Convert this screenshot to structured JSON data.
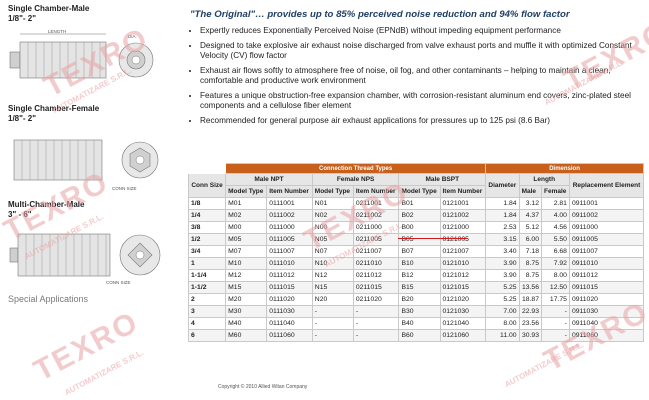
{
  "left": {
    "product1": {
      "title": "Single Chamber-Male",
      "size": "1/8\"- 2\"",
      "length_label": "LENGTH",
      "dia_label": "DIA."
    },
    "product2": {
      "title": "Single Chamber-Female",
      "size": "1/8\"- 2\"",
      "conn_label": "CONN SIZE"
    },
    "product3": {
      "title": "Multi-Chamber-Male",
      "size": "3\" - 6\"",
      "conn_label": "CONN SIZE"
    },
    "special_applications": "Special Applications"
  },
  "headline": "\"The Original\"… provides up to 85% perceived noise reduction and 94% flow factor",
  "bullets": [
    "Expertly reduces Exponentially Perceived Noise (EPNdB) without impeding equipment performance",
    "Designed to take explosive air exhaust noise discharged from valve exhaust ports and muffle it with optimized Constant Velocity (CV) flow factor",
    "Exhaust air flows softly to atmosphere free of noise, oil fog, and other contaminants – helping to maintain a clean, comfortable and productive work environment",
    "Features a unique obstruction-free expansion chamber, with corrosion-resistant aluminum end covers, zinc-plated steel components and a cellulose fiber element",
    "Recommended for general purpose air exhaust applications for pressures up to 125 psi (8.6 Bar)"
  ],
  "table": {
    "band_connection": "Connection Thread Types",
    "band_dimension": "Dimension",
    "conn_size": "Conn Size",
    "male_npt": "Male NPT",
    "female_nps": "Female NPS",
    "male_bspt": "Male BSPT",
    "diameter": "Diameter",
    "length": "Length",
    "replacement": "Replacement Element",
    "model_type": "Model Type",
    "item_number": "Item Number",
    "male": "Male",
    "female": "Female",
    "rows": [
      {
        "size": "1/8",
        "npt_m": "M01",
        "npt_i": "0111001",
        "nps_m": "N01",
        "nps_i": "0211001",
        "bspt_m": "B01",
        "bspt_i": "0121001",
        "dia": "1.84",
        "lm": "3.12",
        "lf": "2.81",
        "rep": "0911001"
      },
      {
        "size": "1/4",
        "npt_m": "M02",
        "npt_i": "0111002",
        "nps_m": "N02",
        "nps_i": "0211002",
        "bspt_m": "B02",
        "bspt_i": "0121002",
        "dia": "1.84",
        "lm": "4.37",
        "lf": "4.00",
        "rep": "0911002"
      },
      {
        "size": "3/8",
        "npt_m": "M00",
        "npt_i": "0111000",
        "nps_m": "N00",
        "nps_i": "0211000",
        "bspt_m": "B00",
        "bspt_i": "0121000",
        "dia": "2.53",
        "lm": "5.12",
        "lf": "4.56",
        "rep": "0911000"
      },
      {
        "size": "1/2",
        "npt_m": "M05",
        "npt_i": "0111005",
        "nps_m": "N05",
        "nps_i": "0211005",
        "bspt_m": "B05",
        "bspt_i": "0121005",
        "dia": "3.15",
        "lm": "6.00",
        "lf": "5.50",
        "rep": "0911005"
      },
      {
        "size": "3/4",
        "npt_m": "M07",
        "npt_i": "0111007",
        "nps_m": "N07",
        "nps_i": "0211007",
        "bspt_m": "B07",
        "bspt_i": "0121007",
        "dia": "3.40",
        "lm": "7.18",
        "lf": "6.68",
        "rep": "0911007"
      },
      {
        "size": "1",
        "npt_m": "M10",
        "npt_i": "0111010",
        "nps_m": "N10",
        "nps_i": "0211010",
        "bspt_m": "B10",
        "bspt_i": "0121010",
        "dia": "3.90",
        "lm": "8.75",
        "lf": "7.92",
        "rep": "0911010"
      },
      {
        "size": "1-1/4",
        "npt_m": "M12",
        "npt_i": "0111012",
        "nps_m": "N12",
        "nps_i": "0211012",
        "bspt_m": "B12",
        "bspt_i": "0121012",
        "dia": "3.90",
        "lm": "8.75",
        "lf": "8.00",
        "rep": "0911012"
      },
      {
        "size": "1-1/2",
        "npt_m": "M15",
        "npt_i": "0111015",
        "nps_m": "N15",
        "nps_i": "0211015",
        "bspt_m": "B15",
        "bspt_i": "0121015",
        "dia": "5.25",
        "lm": "13.56",
        "lf": "12.50",
        "rep": "0911015"
      },
      {
        "size": "2",
        "npt_m": "M20",
        "npt_i": "0111020",
        "nps_m": "N20",
        "nps_i": "0211020",
        "bspt_m": "B20",
        "bspt_i": "0121020",
        "dia": "5.25",
        "lm": "18.87",
        "lf": "17.75",
        "rep": "0911020"
      },
      {
        "size": "3",
        "npt_m": "M30",
        "npt_i": "0111030",
        "nps_m": "-",
        "nps_i": "-",
        "bspt_m": "B30",
        "bspt_i": "0121030",
        "dia": "7.00",
        "lm": "22.93",
        "lf": "-",
        "rep": "0911030"
      },
      {
        "size": "4",
        "npt_m": "M40",
        "npt_i": "0111040",
        "nps_m": "-",
        "nps_i": "-",
        "bspt_m": "B40",
        "bspt_i": "0121040",
        "dia": "8.00",
        "lm": "23.56",
        "lf": "-",
        "rep": "0911040"
      },
      {
        "size": "6",
        "npt_m": "M60",
        "npt_i": "0111060",
        "nps_m": "-",
        "nps_i": "-",
        "bspt_m": "B60",
        "bspt_i": "0121060",
        "dia": "11.00",
        "lm": "30.93",
        "lf": "-",
        "rep": "0911060"
      }
    ]
  },
  "copyright": "Copyright © 2010 Allied Witan Company",
  "watermark": {
    "brand": "TEXRO",
    "sub": "AUTOMATIZARE S.R.L."
  },
  "colors": {
    "band": "#c8601b",
    "headline": "#1f3f66",
    "watermark": "#e8a3a6"
  }
}
